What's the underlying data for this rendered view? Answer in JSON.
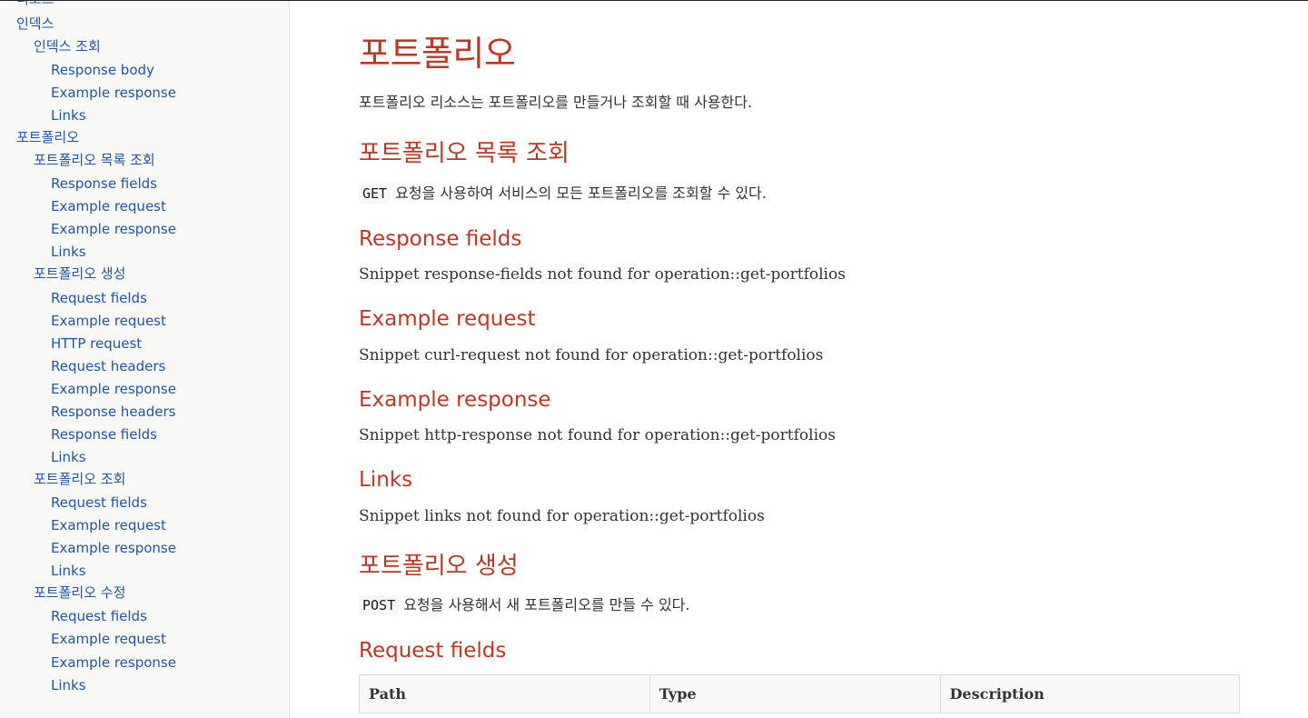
{
  "toc": {
    "items": [
      {
        "label": "리소스",
        "level": 1
      },
      {
        "label": "인덱스",
        "level": 1
      },
      {
        "label": "인덱스 조회",
        "level": 2
      },
      {
        "label": "Response body",
        "level": 3
      },
      {
        "label": "Example response",
        "level": 3
      },
      {
        "label": "Links",
        "level": 3
      },
      {
        "label": "포트폴리오",
        "level": 1
      },
      {
        "label": "포트폴리오 목록 조회",
        "level": 2
      },
      {
        "label": "Response fields",
        "level": 3
      },
      {
        "label": "Example request",
        "level": 3
      },
      {
        "label": "Example response",
        "level": 3
      },
      {
        "label": "Links",
        "level": 3
      },
      {
        "label": "포트폴리오 생성",
        "level": 2
      },
      {
        "label": "Request fields",
        "level": 3
      },
      {
        "label": "Example request",
        "level": 3
      },
      {
        "label": "HTTP request",
        "level": 3
      },
      {
        "label": "Request headers",
        "level": 3
      },
      {
        "label": "Example response",
        "level": 3
      },
      {
        "label": "Response headers",
        "level": 3
      },
      {
        "label": "Response fields",
        "level": 3
      },
      {
        "label": "Links",
        "level": 3
      },
      {
        "label": "포트폴리오 조회",
        "level": 2
      },
      {
        "label": "Request fields",
        "level": 3
      },
      {
        "label": "Example request",
        "level": 3
      },
      {
        "label": "Example response",
        "level": 3
      },
      {
        "label": "Links",
        "level": 3
      },
      {
        "label": "포트폴리오 수정",
        "level": 2
      },
      {
        "label": "Request fields",
        "level": 3
      },
      {
        "label": "Example request",
        "level": 3
      },
      {
        "label": "Example response",
        "level": 3
      },
      {
        "label": "Links",
        "level": 3
      }
    ]
  },
  "content": {
    "title": "포트폴리오",
    "intro": "포트폴리오 리소스는 포트폴리오를 만들거나 조회할 때 사용한다.",
    "list_section": {
      "heading": "포트폴리오 목록 조회",
      "method": "GET",
      "description": " 요청을 사용하여 서비스의 모든 포트폴리오를 조회할 수 있다.",
      "response_fields_heading": "Response fields",
      "response_fields_text": "Snippet response-fields not found for operation::get-portfolios",
      "example_request_heading": "Example request",
      "example_request_text": "Snippet curl-request not found for operation::get-portfolios",
      "example_response_heading": "Example response",
      "example_response_text": "Snippet http-response not found for operation::get-portfolios",
      "links_heading": "Links",
      "links_text": "Snippet links not found for operation::get-portfolios"
    },
    "create_section": {
      "heading": "포트폴리오 생성",
      "method": "POST",
      "description": " 요청을 사용해서 새 포트폴리오를 만들 수 있다.",
      "request_fields_heading": "Request fields",
      "table_headers": [
        "Path",
        "Type",
        "Description"
      ]
    }
  },
  "colors": {
    "heading": "#ba3925",
    "link": "#2156a5",
    "sidebar_bg": "#f8f8f7"
  }
}
